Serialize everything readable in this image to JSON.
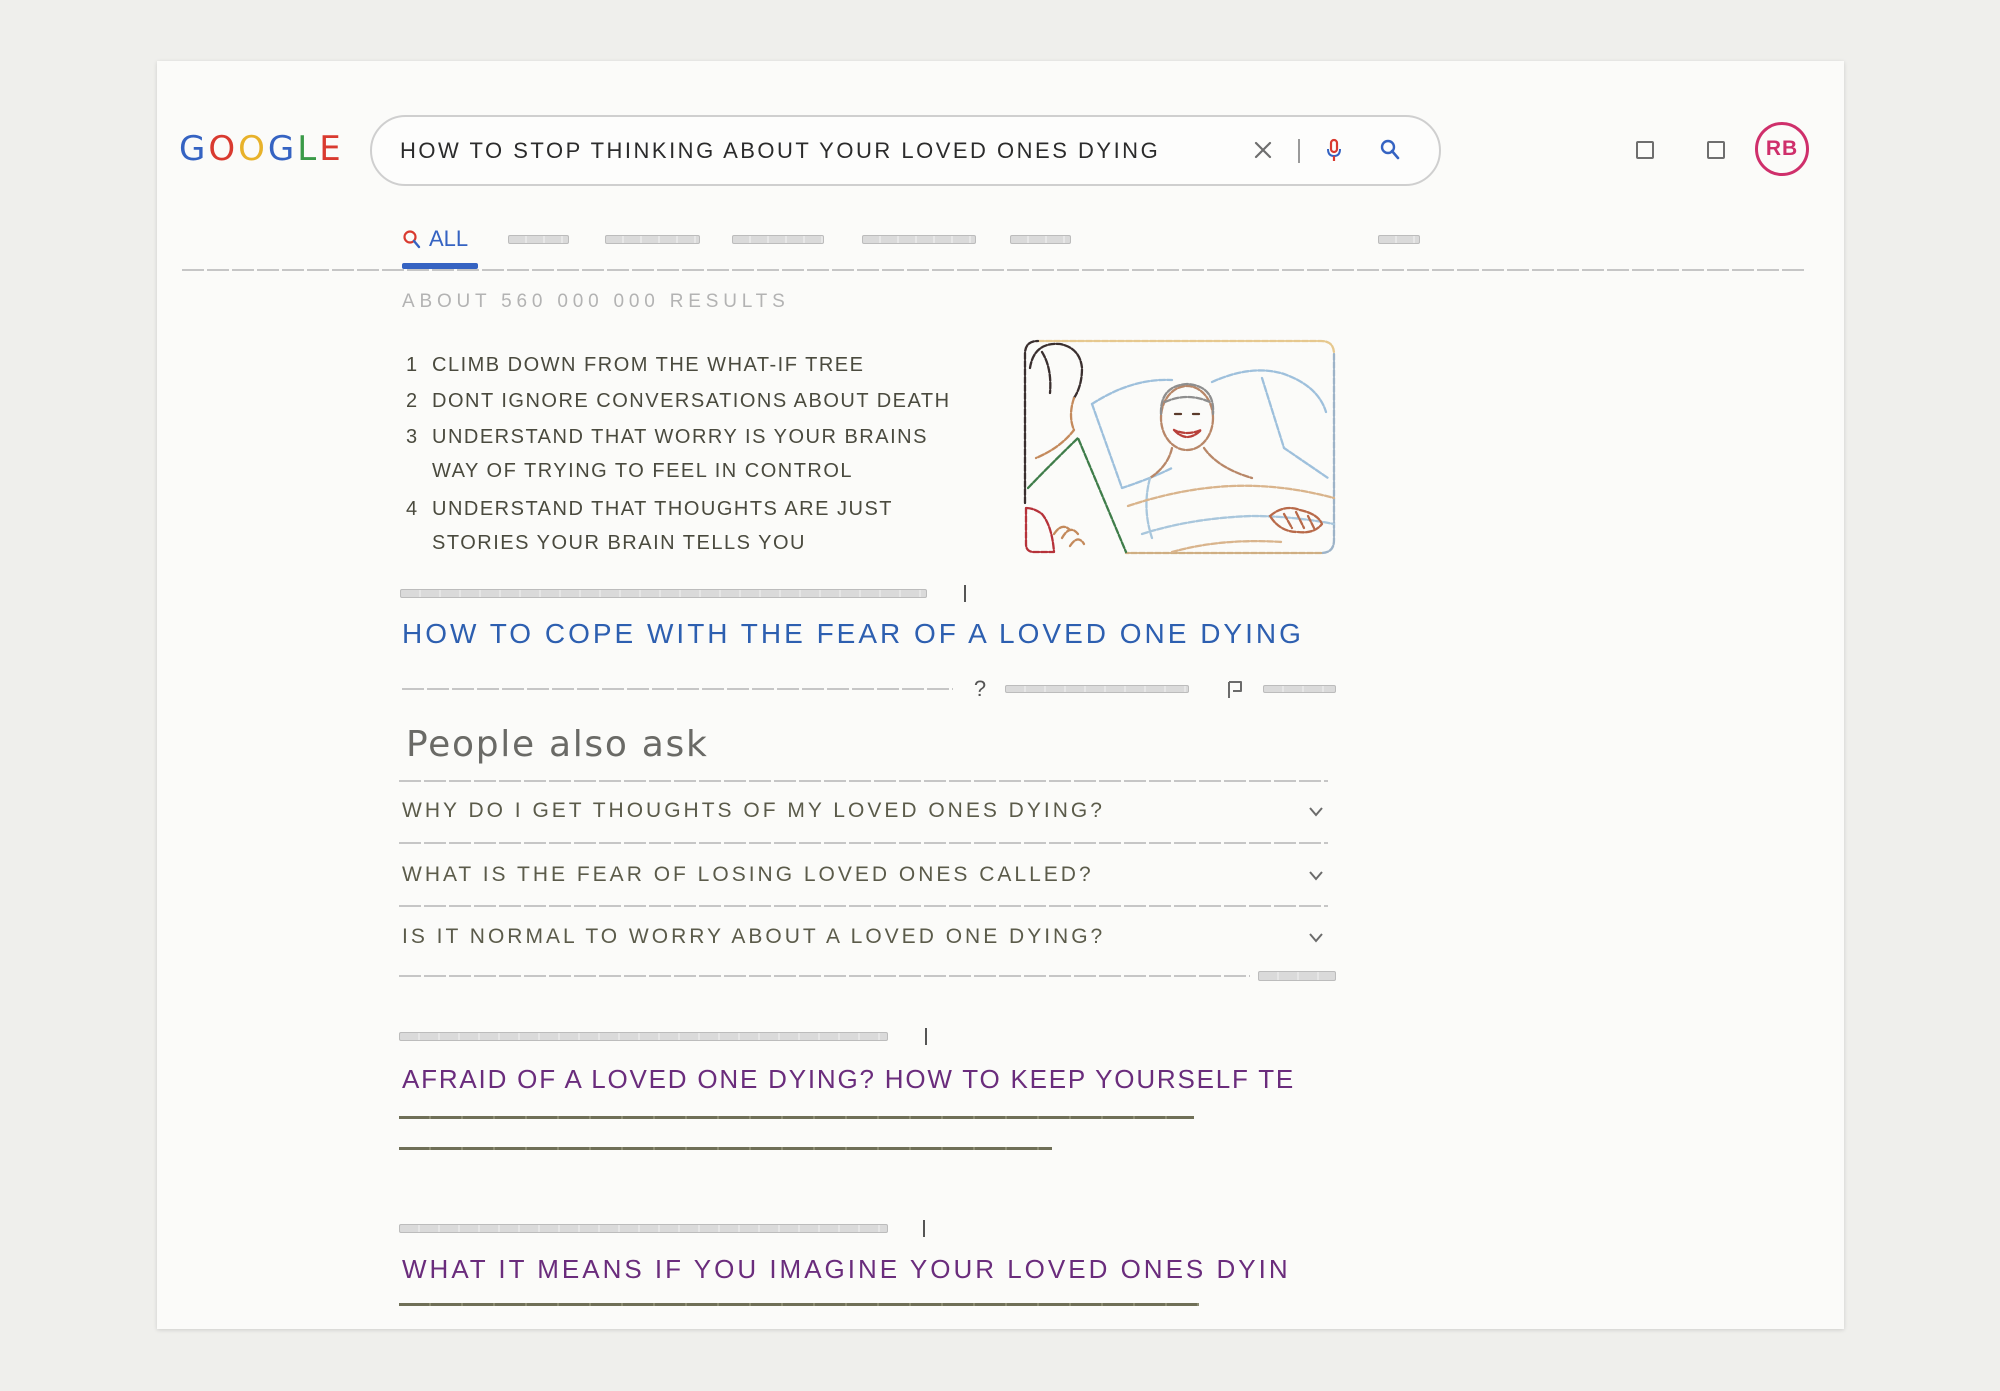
{
  "logo": {
    "letters": [
      {
        "char": "G",
        "color": "#3563c2"
      },
      {
        "char": "O",
        "color": "#d93a2f"
      },
      {
        "char": "O",
        "color": "#e8b22a"
      },
      {
        "char": "G",
        "color": "#3563c2"
      },
      {
        "char": "L",
        "color": "#3a9a47"
      },
      {
        "char": "E",
        "color": "#d93a2f"
      }
    ]
  },
  "search": {
    "query": "HOW TO STOP THINKING ABOUT YOUR LOVED ONES DYING",
    "icons": [
      "close-icon",
      "mic-icon",
      "search-icon"
    ]
  },
  "header": {
    "icons": [
      "square-icon",
      "square-icon"
    ],
    "avatar_initials": "RB"
  },
  "tabs": {
    "active_label": "ALL",
    "active_icon": "search-icon"
  },
  "results_count": "ABOUT 560 000 000 RESULTS",
  "snippet": {
    "items": [
      {
        "num": "1",
        "lines": [
          "CLIMB DOWN FROM THE WHAT-IF TREE"
        ]
      },
      {
        "num": "2",
        "lines": [
          "DONT IGNORE CONVERSATIONS ABOUT DEATH"
        ]
      },
      {
        "num": "3",
        "lines": [
          "UNDERSTAND THAT WORRY IS YOUR BRAINS",
          "WAY OF TRYING TO FEEL IN CONTROL"
        ]
      },
      {
        "num": "4",
        "lines": [
          "UNDERSTAND THAT THOUGHTS ARE JUST",
          "STORIES YOUR BRAIN TELLS YOU"
        ]
      }
    ]
  },
  "top_result": {
    "title": "HOW TO COPE WITH THE FEAR OF A LOVED ONE DYING",
    "help_glyph": "?",
    "feedback_icon": "feedback-flag-icon"
  },
  "people_also_ask": {
    "heading": "People also ask",
    "questions": [
      "WHY DO I GET THOUGHTS OF MY LOVED ONES DYING?",
      "WHAT IS THE FEAR OF LOSING LOVED ONES CALLED?",
      "IS IT NORMAL TO WORRY ABOUT A LOVED ONE DYING?"
    ],
    "expand_icon": "chevron-down-icon"
  },
  "results": [
    {
      "title": "AFRAID OF A LOVED ONE DYING? HOW TO KEEP YOURSELF TE"
    },
    {
      "title": "WHAT IT MEANS IF YOU IMAGINE YOUR LOVED ONES DYIN"
    }
  ],
  "colors": {
    "accent": "#3563c2",
    "link": "#2d5fb0",
    "visited_link": "#6a2c7c",
    "avatar": "#cf2f6b"
  }
}
